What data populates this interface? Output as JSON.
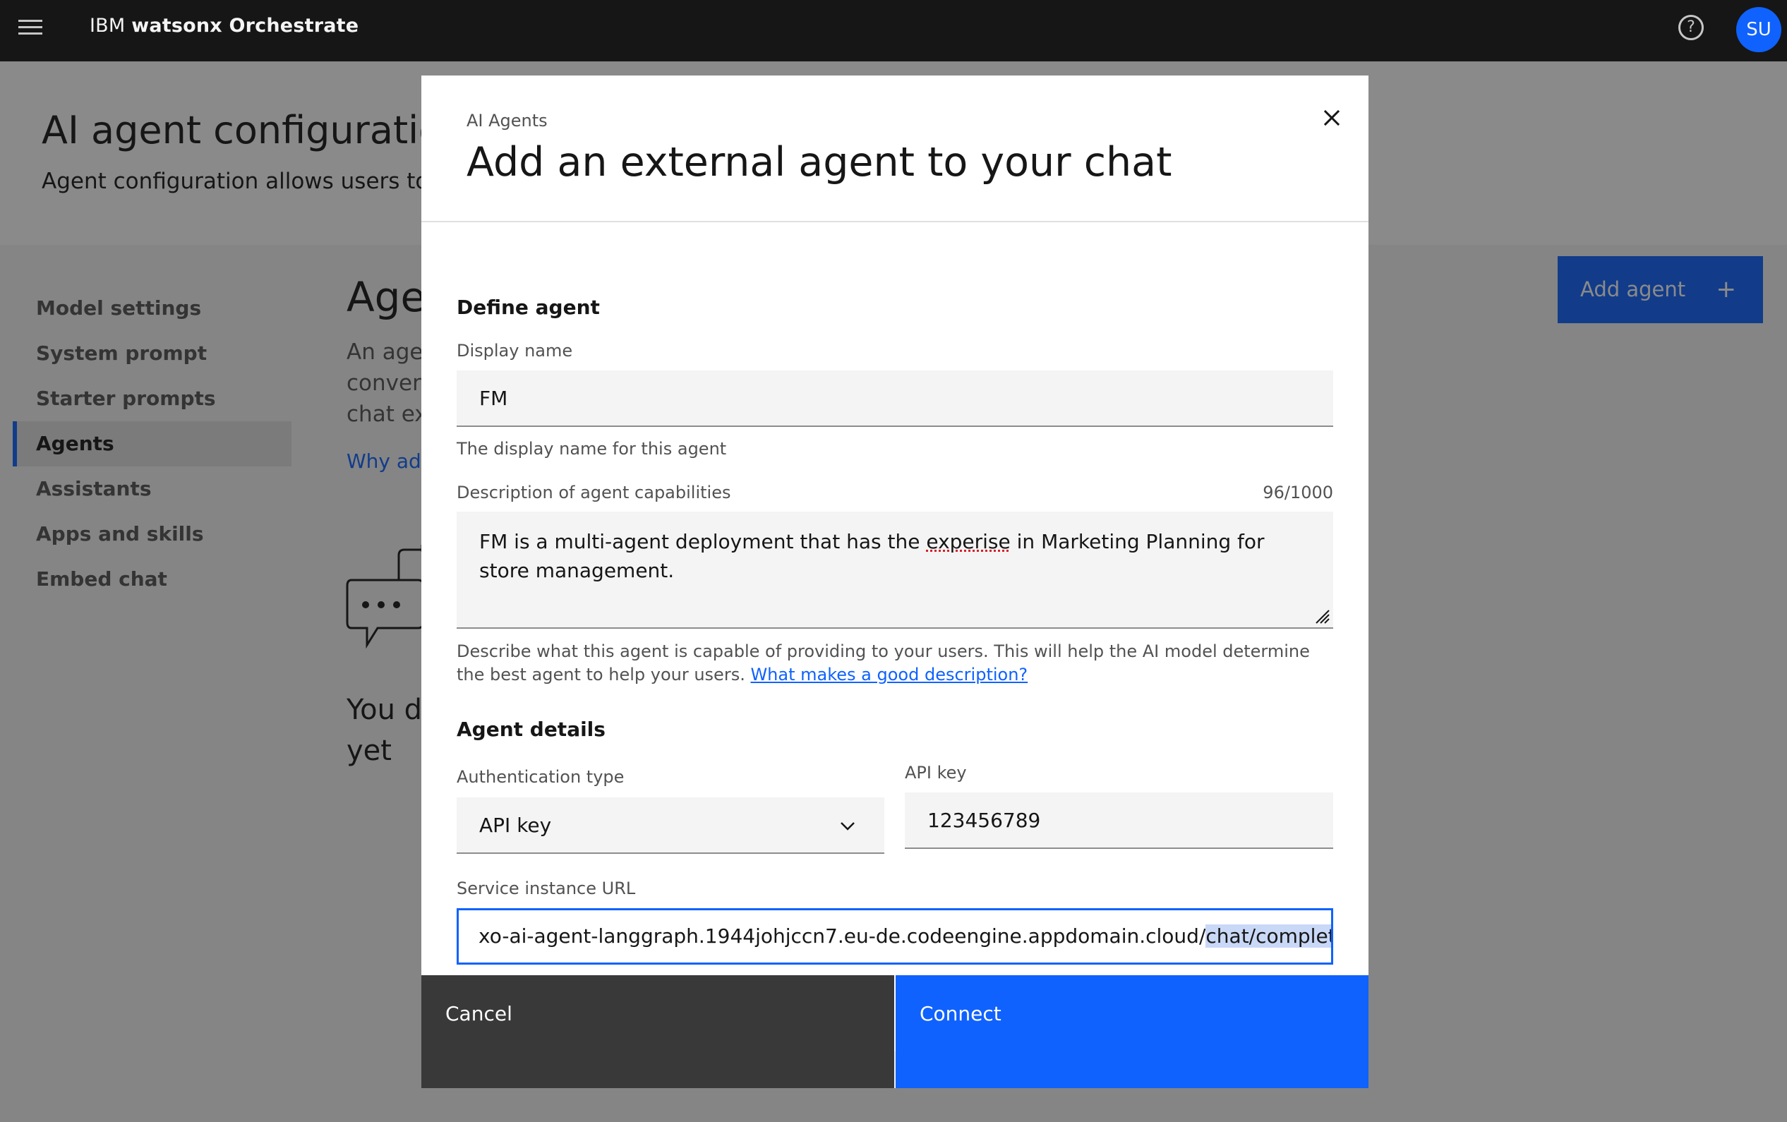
{
  "header": {
    "brand_ibm": "IBM",
    "brand_product": "watsonx Orchestrate",
    "avatar_initials": "SU"
  },
  "page": {
    "title": "AI agent configuration",
    "subtitle": "Agent configuration allows users to cu",
    "nav": [
      {
        "label": "Model settings",
        "active": false
      },
      {
        "label": "System prompt",
        "active": false
      },
      {
        "label": "Starter prompts",
        "active": false
      },
      {
        "label": "Agents",
        "active": true
      },
      {
        "label": "Assistants",
        "active": false
      },
      {
        "label": "Apps and skills",
        "active": false
      },
      {
        "label": "Embed chat",
        "active": false
      }
    ],
    "section_title": "Agen",
    "section_text_1": "An ager",
    "section_text_2": "convers",
    "section_text_3": "chat ex",
    "section_link": "Why add",
    "empty_line_1": "You d",
    "empty_line_2": "yet",
    "add_agent_label": "Add agent",
    "add_agent_icon": "+"
  },
  "modal": {
    "label": "AI Agents",
    "heading": "Add an external agent to your chat",
    "close_icon": "close-icon",
    "define_heading": "Define agent",
    "display_name_label": "Display name",
    "display_name_value": "FM",
    "display_name_helper": "The display name for this agent",
    "description_label": "Description of agent capabilities",
    "description_count": "96/1000",
    "description_value_before": "FM is a multi-agent deployment that has the ",
    "description_value_misspelled": "experise",
    "description_value_after": " in Marketing Planning for store management.",
    "description_helper": "Describe what this agent is capable of providing to your users. This will help the AI model determine the best agent to help your users. ",
    "description_helper_link": "What makes a good description?",
    "details_heading": "Agent details",
    "auth_label": "Authentication type",
    "auth_value": "API key",
    "api_key_label": "API key",
    "api_key_value": "123456789",
    "url_label": "Service instance URL",
    "url_value_plain": "xo-ai-agent-langgraph.1944johjccn7.eu-de.codeengine.appdomain.cloud/",
    "url_value_selected": "chat/completions",
    "cancel_label": "Cancel",
    "connect_label": "Connect"
  },
  "colors": {
    "accent": "#0f62fe",
    "header_bg": "#161616",
    "cancel_bg": "#393939"
  }
}
